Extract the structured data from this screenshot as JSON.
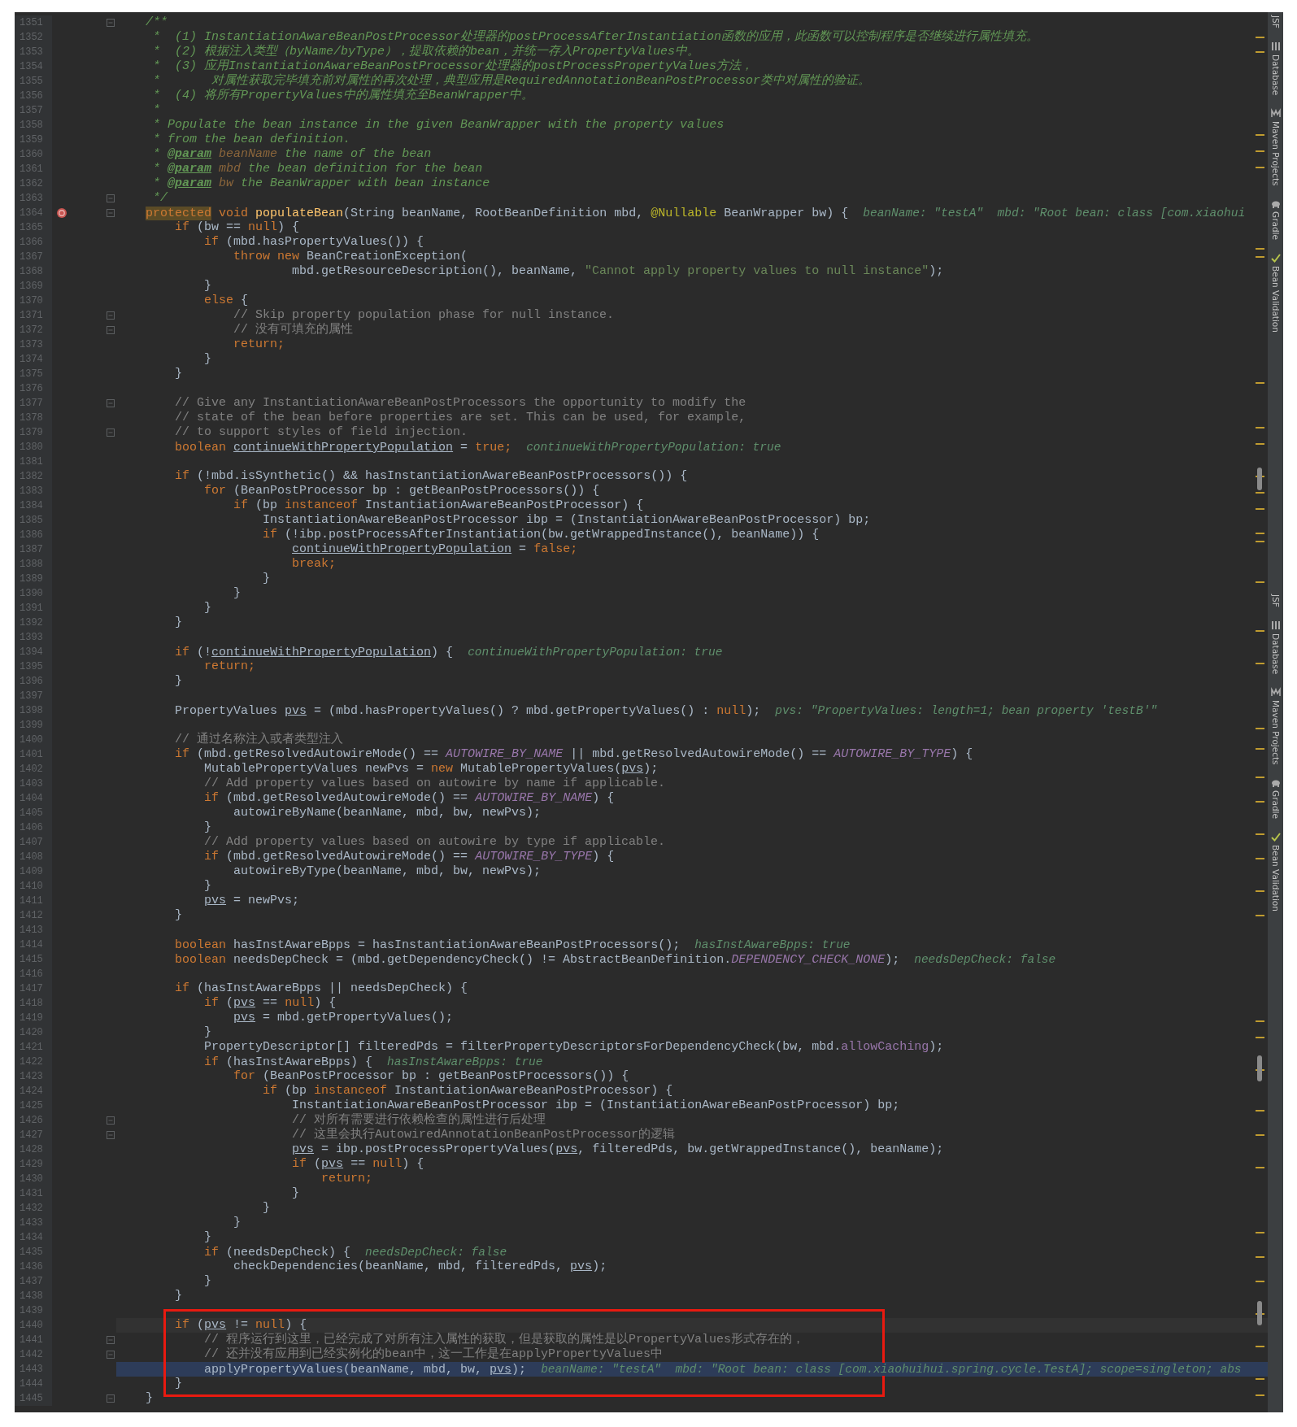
{
  "lines": [
    {
      "number": "1351",
      "fold": true,
      "code": [
        {
          "text": "    /**",
          "kind": "d"
        }
      ]
    },
    {
      "number": "1352",
      "code": [
        {
          "text": "     *  (1) InstantiationAwareBeanPostProcessor处理器的postProcessAfterInstantiation函数的应用，此函数可以控制程序是否继续进行属性填充。",
          "kind": "d"
        }
      ]
    },
    {
      "number": "1353",
      "code": [
        {
          "text": "     *  (2) 根据注入类型（byName/byType），提取依赖的bean，并统一存入PropertyValues中。",
          "kind": "d"
        }
      ]
    },
    {
      "number": "1354",
      "code": [
        {
          "text": "     *  (3) 应用InstantiationAwareBeanPostProcessor处理器的postProcessPropertyValues方法，",
          "kind": "d"
        }
      ]
    },
    {
      "number": "1355",
      "code": [
        {
          "text": "     *       对属性获取完毕填充前对属性的再次处理，典型应用是RequiredAnnotationBeanPostProcessor类中对属性的验证。",
          "kind": "d"
        }
      ]
    },
    {
      "number": "1356",
      "code": [
        {
          "text": "     *  (4) 将所有PropertyValues中的属性填充至BeanWrapper中。",
          "kind": "d"
        }
      ]
    },
    {
      "number": "1357",
      "code": [
        {
          "text": "     *",
          "kind": "d"
        }
      ]
    },
    {
      "number": "1358",
      "code": [
        {
          "text": "     * Populate the bean instance in the given BeanWrapper with the property values",
          "kind": "d"
        }
      ]
    },
    {
      "number": "1359",
      "code": [
        {
          "text": "     * from the bean definition.",
          "kind": "d"
        }
      ]
    },
    {
      "number": "1360",
      "code": [
        {
          "text": "     *",
          "kind": "d"
        },
        {
          "text": " @param",
          "kind": "dt"
        },
        {
          "text": " beanName",
          "kind": "dp"
        },
        {
          "text": " the name of the bean",
          "kind": "d"
        }
      ]
    },
    {
      "number": "1361",
      "code": [
        {
          "text": "     *",
          "kind": "d"
        },
        {
          "text": " @param",
          "kind": "dt"
        },
        {
          "text": " mbd",
          "kind": "dp"
        },
        {
          "text": " the bean definition for the bean",
          "kind": "d"
        }
      ]
    },
    {
      "number": "1362",
      "code": [
        {
          "text": "     *",
          "kind": "d"
        },
        {
          "text": " @param",
          "kind": "dt"
        },
        {
          "text": " bw",
          "kind": "dp"
        },
        {
          "text": " the BeanWrapper with bean instance",
          "kind": "d"
        }
      ]
    },
    {
      "number": "1363",
      "fold": true,
      "code": [
        {
          "text": "     */",
          "kind": "d"
        }
      ]
    },
    {
      "number": "1364",
      "fold": true,
      "breakpoint": true,
      "code": [
        {
          "text": "    protected",
          "kind": "kh"
        },
        {
          "text": " void",
          "kind": "k"
        },
        {
          "text": " populateBean",
          "kind": "m"
        },
        {
          "text": "(String beanName, RootBeanDefinition mbd, ",
          "kind": "p"
        },
        {
          "text": "@Nullable",
          "kind": "a"
        },
        {
          "text": " BeanWrapper bw) {",
          "kind": "p"
        }
      ],
      "hint": "beanName: \"testA\"  mbd: \"Root bean: class [com.xiaohui"
    },
    {
      "number": "1365",
      "code": [
        {
          "text": "        if",
          "kind": "k"
        },
        {
          "text": " (bw == ",
          "kind": "p"
        },
        {
          "text": "null",
          "kind": "k"
        },
        {
          "text": ") {",
          "kind": "p"
        }
      ]
    },
    {
      "number": "1366",
      "code": [
        {
          "text": "            if",
          "kind": "k"
        },
        {
          "text": " (mbd.hasPropertyValues()) {",
          "kind": "p"
        }
      ]
    },
    {
      "number": "1367",
      "code": [
        {
          "text": "                throw new",
          "kind": "k"
        },
        {
          "text": " BeanCreationException(",
          "kind": "p"
        }
      ]
    },
    {
      "number": "1368",
      "code": [
        {
          "text": "                        mbd.getResourceDescription(), beanName, ",
          "kind": "p"
        },
        {
          "text": "\"Cannot apply property values to null instance\"",
          "kind": "s"
        },
        {
          "text": ");",
          "kind": "p"
        }
      ]
    },
    {
      "number": "1369",
      "code": [
        {
          "text": "            }",
          "kind": "p"
        }
      ]
    },
    {
      "number": "1370",
      "code": [
        {
          "text": "            else",
          "kind": "k"
        },
        {
          "text": " {",
          "kind": "p"
        }
      ]
    },
    {
      "number": "1371",
      "fold": true,
      "code": [
        {
          "text": "                // Skip property population phase for null instance.",
          "kind": "c"
        }
      ]
    },
    {
      "number": "1372",
      "fold": true,
      "code": [
        {
          "text": "                // 没有可填充的属性",
          "kind": "c"
        }
      ]
    },
    {
      "number": "1373",
      "code": [
        {
          "text": "                return;",
          "kind": "k"
        }
      ]
    },
    {
      "number": "1374",
      "code": [
        {
          "text": "            }",
          "kind": "p"
        }
      ]
    },
    {
      "number": "1375",
      "code": [
        {
          "text": "        }",
          "kind": "p"
        }
      ]
    },
    {
      "number": "1376"
    },
    {
      "number": "1377",
      "fold": true,
      "code": [
        {
          "text": "        // Give any InstantiationAwareBeanPostProcessors the opportunity to modify the",
          "kind": "c"
        }
      ]
    },
    {
      "number": "1378",
      "code": [
        {
          "text": "        // state of the bean before properties are set. This can be used, for example,",
          "kind": "c"
        }
      ]
    },
    {
      "number": "1379",
      "fold": true,
      "code": [
        {
          "text": "        // to support styles of field injection.",
          "kind": "c"
        }
      ]
    },
    {
      "number": "1380",
      "code": [
        {
          "text": "        boolean",
          "kind": "k"
        },
        {
          "text": " continueWithPropertyPopulation",
          "kind": "u"
        },
        {
          "text": " = ",
          "kind": "p"
        },
        {
          "text": "true;",
          "kind": "k"
        }
      ],
      "hint": "continueWithPropertyPopulation: true"
    },
    {
      "number": "1381"
    },
    {
      "number": "1382",
      "code": [
        {
          "text": "        if",
          "kind": "k"
        },
        {
          "text": " (!mbd.isSynthetic() && hasInstantiationAwareBeanPostProcessors()) {",
          "kind": "p"
        }
      ]
    },
    {
      "number": "1383",
      "code": [
        {
          "text": "            for",
          "kind": "k"
        },
        {
          "text": " (BeanPostProcessor bp : getBeanPostProcessors()) {",
          "kind": "p"
        }
      ]
    },
    {
      "number": "1384",
      "code": [
        {
          "text": "                if",
          "kind": "k"
        },
        {
          "text": " (bp ",
          "kind": "p"
        },
        {
          "text": "instanceof",
          "kind": "k"
        },
        {
          "text": " InstantiationAwareBeanPostProcessor) {",
          "kind": "p"
        }
      ]
    },
    {
      "number": "1385",
      "code": [
        {
          "text": "                    InstantiationAwareBeanPostProcessor ibp = (InstantiationAwareBeanPostProcessor) bp;",
          "kind": "p"
        }
      ]
    },
    {
      "number": "1386",
      "code": [
        {
          "text": "                    if",
          "kind": "k"
        },
        {
          "text": " (!ibp.postProcessAfterInstantiation(bw.getWrappedInstance(), beanName)) {",
          "kind": "p"
        }
      ]
    },
    {
      "number": "1387",
      "code": [
        {
          "text": "                        continueWithPropertyPopulation",
          "kind": "u"
        },
        {
          "text": " = ",
          "kind": "p"
        },
        {
          "text": "false;",
          "kind": "k"
        }
      ]
    },
    {
      "number": "1388",
      "code": [
        {
          "text": "                        break;",
          "kind": "k"
        }
      ]
    },
    {
      "number": "1389",
      "code": [
        {
          "text": "                    }",
          "kind": "p"
        }
      ]
    },
    {
      "number": "1390",
      "code": [
        {
          "text": "                }",
          "kind": "p"
        }
      ]
    },
    {
      "number": "1391",
      "code": [
        {
          "text": "            }",
          "kind": "p"
        }
      ]
    },
    {
      "number": "1392",
      "code": [
        {
          "text": "        }",
          "kind": "p"
        }
      ]
    },
    {
      "number": "1393"
    },
    {
      "number": "1394",
      "code": [
        {
          "text": "        if",
          "kind": "k"
        },
        {
          "text": " (!",
          "kind": "p"
        },
        {
          "text": "continueWithPropertyPopulation",
          "kind": "u"
        },
        {
          "text": ") {",
          "kind": "p"
        }
      ],
      "hint": "continueWithPropertyPopulation: true"
    },
    {
      "number": "1395",
      "code": [
        {
          "text": "            return;",
          "kind": "k"
        }
      ]
    },
    {
      "number": "1396",
      "code": [
        {
          "text": "        }",
          "kind": "p"
        }
      ]
    },
    {
      "number": "1397"
    },
    {
      "number": "1398",
      "code": [
        {
          "text": "        PropertyValues ",
          "kind": "p"
        },
        {
          "text": "pvs",
          "kind": "u"
        },
        {
          "text": " = (mbd.hasPropertyValues() ? mbd.getPropertyValues() : ",
          "kind": "p"
        },
        {
          "text": "null",
          "kind": "k"
        },
        {
          "text": ");",
          "kind": "p"
        }
      ],
      "hint": "pvs: \"PropertyValues: length=1; bean property 'testB'\""
    },
    {
      "number": "1399"
    },
    {
      "number": "1400",
      "code": [
        {
          "text": "        // 通过名称注入或者类型注入",
          "kind": "c"
        }
      ]
    },
    {
      "number": "1401",
      "code": [
        {
          "text": "        if",
          "kind": "k"
        },
        {
          "text": " (mbd.getResolvedAutowireMode() == ",
          "kind": "p"
        },
        {
          "text": "AUTOWIRE_BY_NAME",
          "kind": "i"
        },
        {
          "text": " || mbd.getResolvedAutowireMode() == ",
          "kind": "p"
        },
        {
          "text": "AUTOWIRE_BY_TYPE",
          "kind": "i"
        },
        {
          "text": ") {",
          "kind": "p"
        }
      ]
    },
    {
      "number": "1402",
      "code": [
        {
          "text": "            MutablePropertyValues newPvs = ",
          "kind": "p"
        },
        {
          "text": "new",
          "kind": "k"
        },
        {
          "text": " MutablePropertyValues(",
          "kind": "p"
        },
        {
          "text": "pvs",
          "kind": "u"
        },
        {
          "text": ");",
          "kind": "p"
        }
      ]
    },
    {
      "number": "1403",
      "code": [
        {
          "text": "            // Add property values based on autowire by name if applicable.",
          "kind": "c"
        }
      ]
    },
    {
      "number": "1404",
      "code": [
        {
          "text": "            if",
          "kind": "k"
        },
        {
          "text": " (mbd.getResolvedAutowireMode() == ",
          "kind": "p"
        },
        {
          "text": "AUTOWIRE_BY_NAME",
          "kind": "i"
        },
        {
          "text": ") {",
          "kind": "p"
        }
      ]
    },
    {
      "number": "1405",
      "code": [
        {
          "text": "                autowireByName(beanName, mbd, bw, newPvs);",
          "kind": "p"
        }
      ]
    },
    {
      "number": "1406",
      "code": [
        {
          "text": "            }",
          "kind": "p"
        }
      ]
    },
    {
      "number": "1407",
      "code": [
        {
          "text": "            // Add property values based on autowire by type if applicable.",
          "kind": "c"
        }
      ]
    },
    {
      "number": "1408",
      "code": [
        {
          "text": "            if",
          "kind": "k"
        },
        {
          "text": " (mbd.getResolvedAutowireMode() == ",
          "kind": "p"
        },
        {
          "text": "AUTOWIRE_BY_TYPE",
          "kind": "i"
        },
        {
          "text": ") {",
          "kind": "p"
        }
      ]
    },
    {
      "number": "1409",
      "code": [
        {
          "text": "                autowireByType(beanName, mbd, bw, newPvs);",
          "kind": "p"
        }
      ]
    },
    {
      "number": "1410",
      "code": [
        {
          "text": "            }",
          "kind": "p"
        }
      ]
    },
    {
      "number": "1411",
      "code": [
        {
          "text": "            pvs",
          "kind": "u"
        },
        {
          "text": " = newPvs;",
          "kind": "p"
        }
      ]
    },
    {
      "number": "1412",
      "code": [
        {
          "text": "        }",
          "kind": "p"
        }
      ]
    },
    {
      "number": "1413"
    },
    {
      "number": "1414",
      "code": [
        {
          "text": "        boolean",
          "kind": "k"
        },
        {
          "text": " hasInstAwareBpps = hasInstantiationAwareBeanPostProcessors();",
          "kind": "p"
        }
      ],
      "hint": "hasInstAwareBpps: true"
    },
    {
      "number": "1415",
      "code": [
        {
          "text": "        boolean",
          "kind": "k"
        },
        {
          "text": " needsDepCheck = (mbd.getDependencyCheck() != AbstractBeanDefinition.",
          "kind": "p"
        },
        {
          "text": "DEPENDENCY_CHECK_NONE",
          "kind": "i"
        },
        {
          "text": ");",
          "kind": "p"
        }
      ],
      "hint": "needsDepCheck: false"
    },
    {
      "number": "1416"
    },
    {
      "number": "1417",
      "code": [
        {
          "text": "        if",
          "kind": "k"
        },
        {
          "text": " (hasInstAwareBpps || needsDepCheck) {",
          "kind": "p"
        }
      ]
    },
    {
      "number": "1418",
      "code": [
        {
          "text": "            if",
          "kind": "k"
        },
        {
          "text": " (",
          "kind": "p"
        },
        {
          "text": "pvs",
          "kind": "u"
        },
        {
          "text": " == ",
          "kind": "p"
        },
        {
          "text": "null",
          "kind": "k"
        },
        {
          "text": ") {",
          "kind": "p"
        }
      ]
    },
    {
      "number": "1419",
      "code": [
        {
          "text": "                pvs",
          "kind": "u"
        },
        {
          "text": " = mbd.getPropertyValues();",
          "kind": "p"
        }
      ]
    },
    {
      "number": "1420",
      "code": [
        {
          "text": "            }",
          "kind": "p"
        }
      ]
    },
    {
      "number": "1421",
      "code": [
        {
          "text": "            PropertyDescriptor[] filteredPds = filterPropertyDescriptorsForDependencyCheck(bw, mbd.",
          "kind": "p"
        },
        {
          "text": "allowCaching",
          "kind": "f"
        },
        {
          "text": ");",
          "kind": "p"
        }
      ]
    },
    {
      "number": "1422",
      "code": [
        {
          "text": "            if",
          "kind": "k"
        },
        {
          "text": " (hasInstAwareBpps) {",
          "kind": "p"
        }
      ],
      "hint": "hasInstAwareBpps: true"
    },
    {
      "number": "1423",
      "code": [
        {
          "text": "                for",
          "kind": "k"
        },
        {
          "text": " (BeanPostProcessor bp : getBeanPostProcessors()) {",
          "kind": "p"
        }
      ]
    },
    {
      "number": "1424",
      "code": [
        {
          "text": "                    if",
          "kind": "k"
        },
        {
          "text": " (bp ",
          "kind": "p"
        },
        {
          "text": "instanceof",
          "kind": "k"
        },
        {
          "text": " InstantiationAwareBeanPostProcessor) {",
          "kind": "p"
        }
      ]
    },
    {
      "number": "1425",
      "code": [
        {
          "text": "                        InstantiationAwareBeanPostProcessor ibp = (InstantiationAwareBeanPostProcessor) bp;",
          "kind": "p"
        }
      ]
    },
    {
      "number": "1426",
      "fold": true,
      "code": [
        {
          "text": "                        // 对所有需要进行依赖检查的属性进行后处理",
          "kind": "c"
        }
      ]
    },
    {
      "number": "1427",
      "fold": true,
      "code": [
        {
          "text": "                        // 这里会执行AutowiredAnnotationBeanPostProcessor的逻辑",
          "kind": "c"
        }
      ]
    },
    {
      "number": "1428",
      "code": [
        {
          "text": "                        pvs",
          "kind": "u"
        },
        {
          "text": " = ibp.postProcessPropertyValues(",
          "kind": "p"
        },
        {
          "text": "pvs",
          "kind": "u"
        },
        {
          "text": ", filteredPds, bw.getWrappedInstance(), beanName);",
          "kind": "p"
        }
      ]
    },
    {
      "number": "1429",
      "code": [
        {
          "text": "                        if",
          "kind": "k"
        },
        {
          "text": " (",
          "kind": "p"
        },
        {
          "text": "pvs",
          "kind": "u"
        },
        {
          "text": " == ",
          "kind": "p"
        },
        {
          "text": "null",
          "kind": "k"
        },
        {
          "text": ") {",
          "kind": "p"
        }
      ]
    },
    {
      "number": "1430",
      "code": [
        {
          "text": "                            return;",
          "kind": "k"
        }
      ]
    },
    {
      "number": "1431",
      "code": [
        {
          "text": "                        }",
          "kind": "p"
        }
      ]
    },
    {
      "number": "1432",
      "code": [
        {
          "text": "                    }",
          "kind": "p"
        }
      ]
    },
    {
      "number": "1433",
      "code": [
        {
          "text": "                }",
          "kind": "p"
        }
      ]
    },
    {
      "number": "1434",
      "code": [
        {
          "text": "            }",
          "kind": "p"
        }
      ]
    },
    {
      "number": "1435",
      "code": [
        {
          "text": "            if",
          "kind": "k"
        },
        {
          "text": " (needsDepCheck) {",
          "kind": "p"
        }
      ],
      "hint": "needsDepCheck: false"
    },
    {
      "number": "1436",
      "code": [
        {
          "text": "                checkDependencies(beanName, mbd, filteredPds, ",
          "kind": "p"
        },
        {
          "text": "pvs",
          "kind": "u"
        },
        {
          "text": ");",
          "kind": "p"
        }
      ]
    },
    {
      "number": "1437",
      "code": [
        {
          "text": "            }",
          "kind": "p"
        }
      ]
    },
    {
      "number": "1438",
      "code": [
        {
          "text": "        }",
          "kind": "p"
        }
      ]
    },
    {
      "number": "1439"
    },
    {
      "number": "1440",
      "caret_line": true,
      "boxed": true,
      "code": [
        {
          "text": "        if",
          "kind": "k"
        },
        {
          "text": " (",
          "kind": "p"
        },
        {
          "text": "pvs",
          "kind": "u"
        },
        {
          "text": " != ",
          "kind": "p"
        },
        {
          "text": "null",
          "kind": "k"
        },
        {
          "text": ") {",
          "kind": "p"
        }
      ]
    },
    {
      "number": "1441",
      "fold": true,
      "boxed": true,
      "code": [
        {
          "text": "            // 程序运行到这里，已经完成了对所有注入属性的获取，但是获取的属性是以PropertyValues形式存在的，",
          "kind": "c"
        }
      ]
    },
    {
      "number": "1442",
      "fold": true,
      "boxed": true,
      "code": [
        {
          "text": "            // 还并没有应用到已经实例化的bean中，这一工作是在applyPropertyValues中",
          "kind": "c"
        }
      ]
    },
    {
      "number": "1443",
      "execution_point": true,
      "boxed": true,
      "code": [
        {
          "text": "            applyPropertyValues(beanName, mbd, bw, ",
          "kind": "p"
        },
        {
          "text": "pvs",
          "kind": "u"
        },
        {
          "text": ");",
          "kind": "p"
        }
      ],
      "hint": "beanName: \"testA\"  mbd: \"Root bean: class [com.xiaohuihui.spring.cycle.TestA]; scope=singleton; abs"
    },
    {
      "number": "1444",
      "boxed": true,
      "code": [
        {
          "text": "        }",
          "kind": "p"
        }
      ]
    },
    {
      "number": "1445",
      "fold": true,
      "code": [
        {
          "text": "    }",
          "kind": "p"
        }
      ]
    }
  ],
  "tool_stripe": [
    {
      "tabs": [
        "JSF",
        "Database",
        "Maven Projects",
        "Gradle",
        "Bean Validation"
      ]
    },
    {
      "tabs": [
        "JSF",
        "Database",
        "Maven Projects",
        "Gradle",
        "Bean Validation"
      ]
    }
  ]
}
